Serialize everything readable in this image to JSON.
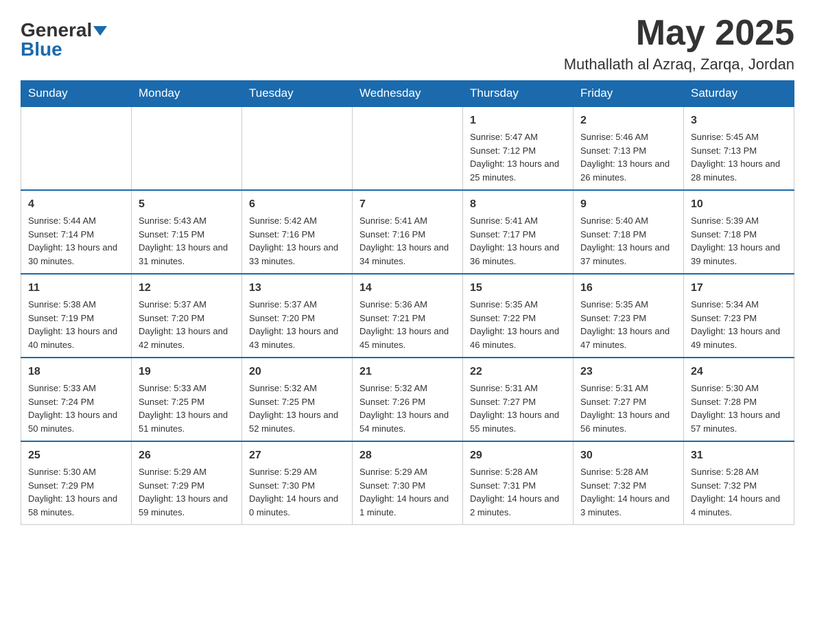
{
  "header": {
    "logo_general": "General",
    "logo_blue": "Blue",
    "month_title": "May 2025",
    "location": "Muthallath al Azraq, Zarqa, Jordan"
  },
  "days_of_week": [
    "Sunday",
    "Monday",
    "Tuesday",
    "Wednesday",
    "Thursday",
    "Friday",
    "Saturday"
  ],
  "weeks": [
    [
      {
        "day": "",
        "info": ""
      },
      {
        "day": "",
        "info": ""
      },
      {
        "day": "",
        "info": ""
      },
      {
        "day": "",
        "info": ""
      },
      {
        "day": "1",
        "info": "Sunrise: 5:47 AM\nSunset: 7:12 PM\nDaylight: 13 hours and 25 minutes."
      },
      {
        "day": "2",
        "info": "Sunrise: 5:46 AM\nSunset: 7:13 PM\nDaylight: 13 hours and 26 minutes."
      },
      {
        "day": "3",
        "info": "Sunrise: 5:45 AM\nSunset: 7:13 PM\nDaylight: 13 hours and 28 minutes."
      }
    ],
    [
      {
        "day": "4",
        "info": "Sunrise: 5:44 AM\nSunset: 7:14 PM\nDaylight: 13 hours and 30 minutes."
      },
      {
        "day": "5",
        "info": "Sunrise: 5:43 AM\nSunset: 7:15 PM\nDaylight: 13 hours and 31 minutes."
      },
      {
        "day": "6",
        "info": "Sunrise: 5:42 AM\nSunset: 7:16 PM\nDaylight: 13 hours and 33 minutes."
      },
      {
        "day": "7",
        "info": "Sunrise: 5:41 AM\nSunset: 7:16 PM\nDaylight: 13 hours and 34 minutes."
      },
      {
        "day": "8",
        "info": "Sunrise: 5:41 AM\nSunset: 7:17 PM\nDaylight: 13 hours and 36 minutes."
      },
      {
        "day": "9",
        "info": "Sunrise: 5:40 AM\nSunset: 7:18 PM\nDaylight: 13 hours and 37 minutes."
      },
      {
        "day": "10",
        "info": "Sunrise: 5:39 AM\nSunset: 7:18 PM\nDaylight: 13 hours and 39 minutes."
      }
    ],
    [
      {
        "day": "11",
        "info": "Sunrise: 5:38 AM\nSunset: 7:19 PM\nDaylight: 13 hours and 40 minutes."
      },
      {
        "day": "12",
        "info": "Sunrise: 5:37 AM\nSunset: 7:20 PM\nDaylight: 13 hours and 42 minutes."
      },
      {
        "day": "13",
        "info": "Sunrise: 5:37 AM\nSunset: 7:20 PM\nDaylight: 13 hours and 43 minutes."
      },
      {
        "day": "14",
        "info": "Sunrise: 5:36 AM\nSunset: 7:21 PM\nDaylight: 13 hours and 45 minutes."
      },
      {
        "day": "15",
        "info": "Sunrise: 5:35 AM\nSunset: 7:22 PM\nDaylight: 13 hours and 46 minutes."
      },
      {
        "day": "16",
        "info": "Sunrise: 5:35 AM\nSunset: 7:23 PM\nDaylight: 13 hours and 47 minutes."
      },
      {
        "day": "17",
        "info": "Sunrise: 5:34 AM\nSunset: 7:23 PM\nDaylight: 13 hours and 49 minutes."
      }
    ],
    [
      {
        "day": "18",
        "info": "Sunrise: 5:33 AM\nSunset: 7:24 PM\nDaylight: 13 hours and 50 minutes."
      },
      {
        "day": "19",
        "info": "Sunrise: 5:33 AM\nSunset: 7:25 PM\nDaylight: 13 hours and 51 minutes."
      },
      {
        "day": "20",
        "info": "Sunrise: 5:32 AM\nSunset: 7:25 PM\nDaylight: 13 hours and 52 minutes."
      },
      {
        "day": "21",
        "info": "Sunrise: 5:32 AM\nSunset: 7:26 PM\nDaylight: 13 hours and 54 minutes."
      },
      {
        "day": "22",
        "info": "Sunrise: 5:31 AM\nSunset: 7:27 PM\nDaylight: 13 hours and 55 minutes."
      },
      {
        "day": "23",
        "info": "Sunrise: 5:31 AM\nSunset: 7:27 PM\nDaylight: 13 hours and 56 minutes."
      },
      {
        "day": "24",
        "info": "Sunrise: 5:30 AM\nSunset: 7:28 PM\nDaylight: 13 hours and 57 minutes."
      }
    ],
    [
      {
        "day": "25",
        "info": "Sunrise: 5:30 AM\nSunset: 7:29 PM\nDaylight: 13 hours and 58 minutes."
      },
      {
        "day": "26",
        "info": "Sunrise: 5:29 AM\nSunset: 7:29 PM\nDaylight: 13 hours and 59 minutes."
      },
      {
        "day": "27",
        "info": "Sunrise: 5:29 AM\nSunset: 7:30 PM\nDaylight: 14 hours and 0 minutes."
      },
      {
        "day": "28",
        "info": "Sunrise: 5:29 AM\nSunset: 7:30 PM\nDaylight: 14 hours and 1 minute."
      },
      {
        "day": "29",
        "info": "Sunrise: 5:28 AM\nSunset: 7:31 PM\nDaylight: 14 hours and 2 minutes."
      },
      {
        "day": "30",
        "info": "Sunrise: 5:28 AM\nSunset: 7:32 PM\nDaylight: 14 hours and 3 minutes."
      },
      {
        "day": "31",
        "info": "Sunrise: 5:28 AM\nSunset: 7:32 PM\nDaylight: 14 hours and 4 minutes."
      }
    ]
  ]
}
